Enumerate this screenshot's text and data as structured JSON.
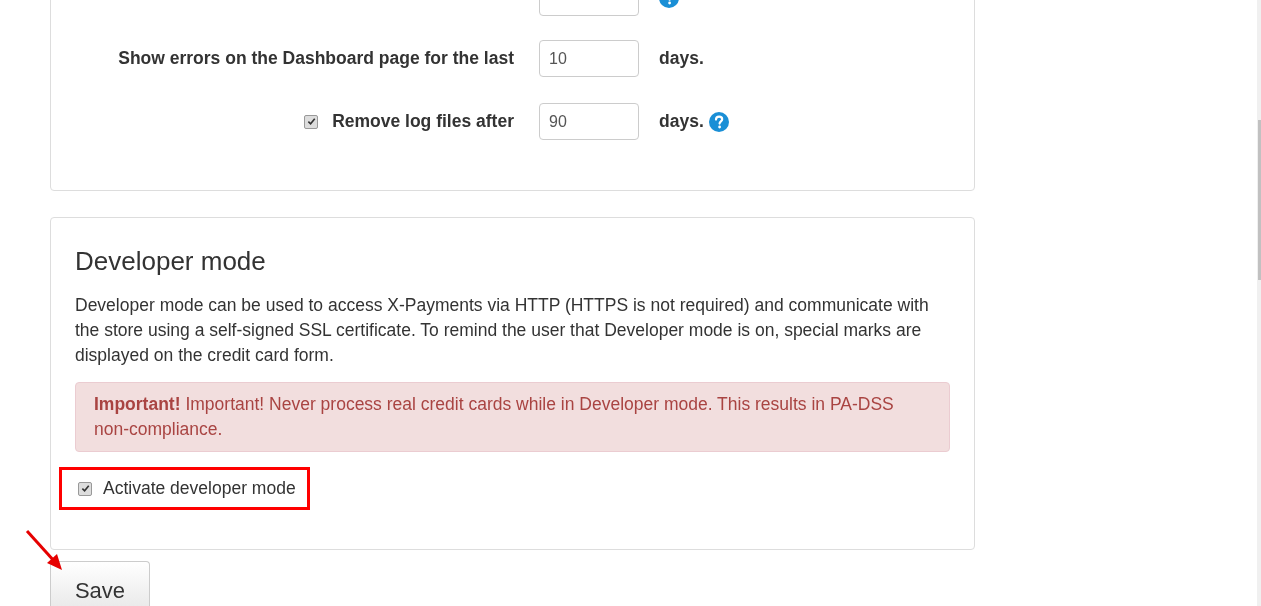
{
  "log_settings": {
    "rows": [
      {
        "kind": "cut",
        "help": true
      },
      {
        "kind": "plain",
        "label": "Show errors on the Dashboard page for the last",
        "value": "10",
        "unit": "days.",
        "help": false
      },
      {
        "kind": "check",
        "checked": true,
        "label": "Remove log files after",
        "value": "90",
        "unit": "days.",
        "help": true
      }
    ]
  },
  "developer_mode": {
    "title": "Developer mode",
    "description": "Developer mode can be used to access X-Payments via HTTP (HTTPS is not required) and communicate with the store using a self-signed SSL certificate. To remind the user that Developer mode is on, special marks are displayed on the credit card form.",
    "alert": "**Important!** Important! Never process real credit cards while in Developer mode. This results in PA-DSS non-compliance.",
    "activate": {
      "label": "Activate developer mode",
      "checked": true,
      "highlighted": true
    }
  },
  "save_button": {
    "label": "Save",
    "arrow": true
  }
}
